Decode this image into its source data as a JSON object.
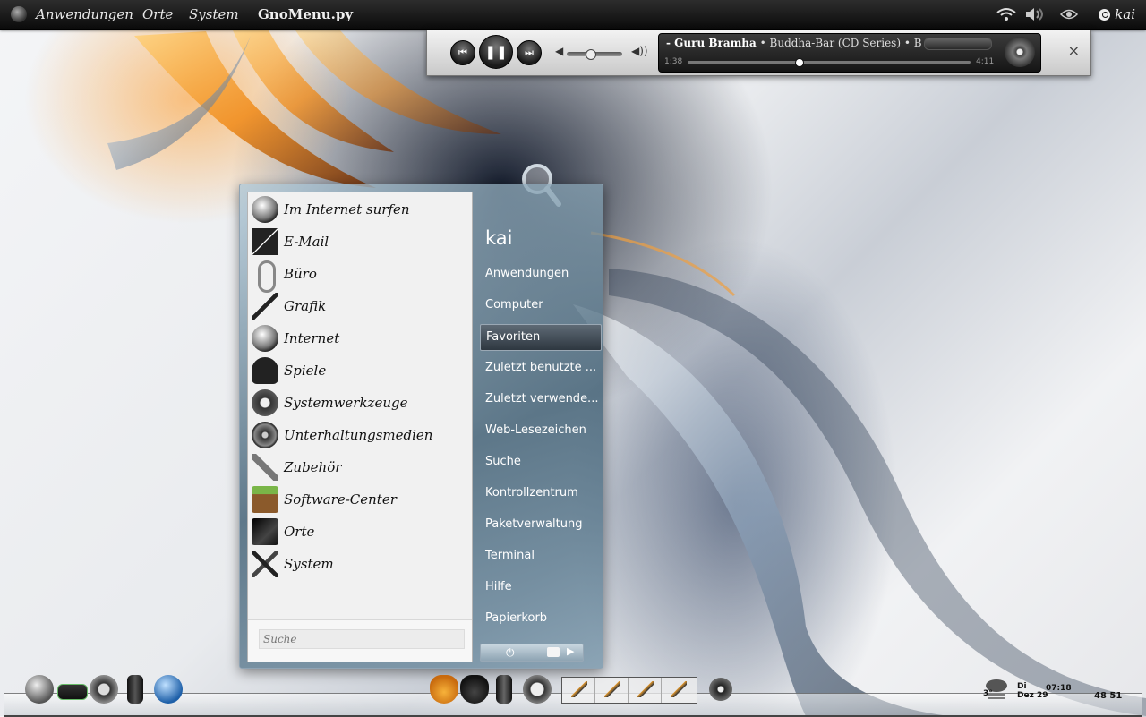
{
  "top_panel": {
    "menus": [
      "Anwendungen",
      "Orte",
      "System"
    ],
    "app_title": "GnoMenu.py",
    "user": "kai"
  },
  "player": {
    "track_artist": "- Guru Bramha",
    "track_rest": "• Buddha-Bar (CD Series) • Buddha-",
    "elapsed": "1:38",
    "duration": "4:11",
    "progress_fraction": 0.39,
    "volume_fraction": 0.4,
    "close_label": "×"
  },
  "gnomenu": {
    "user_name": "kai",
    "apps": [
      {
        "label": "Im Internet surfen",
        "icon": "globe-icon"
      },
      {
        "label": "E-Mail",
        "icon": "envelope-icon"
      },
      {
        "label": "Büro",
        "icon": "paperclip-icon"
      },
      {
        "label": "Grafik",
        "icon": "brush-icon"
      },
      {
        "label": "Internet",
        "icon": "globe-icon"
      },
      {
        "label": "Spiele",
        "icon": "ghost-icon"
      },
      {
        "label": "Systemwerkzeuge",
        "icon": "gear-icon"
      },
      {
        "label": "Unterhaltungsmedien",
        "icon": "film-reel-icon"
      },
      {
        "label": "Zubehör",
        "icon": "tools-icon"
      },
      {
        "label": "Software-Center",
        "icon": "package-icon"
      },
      {
        "label": "Orte",
        "icon": "folder-icon"
      },
      {
        "label": "System",
        "icon": "wrench-screwdriver-icon"
      }
    ],
    "search_placeholder": "Suche",
    "places": [
      "Anwendungen",
      "Computer",
      "Favoriten",
      "Zuletzt benutzte ...",
      "Zuletzt verwende...",
      "Web-Lesezeichen",
      "Suche",
      "Kontrollzentrum",
      "Paketverwaltung",
      "Terminal",
      "Hilfe",
      "Papierkorb"
    ],
    "active_place_index": 2
  },
  "dock": {
    "clock_day": "Di",
    "clock_date": "Dez 29",
    "clock_time": "07:18",
    "weather_temp": "3°",
    "sys_nums": "48 51",
    "colors": {
      "accent": "#e39a30",
      "panel": "#111111"
    }
  }
}
